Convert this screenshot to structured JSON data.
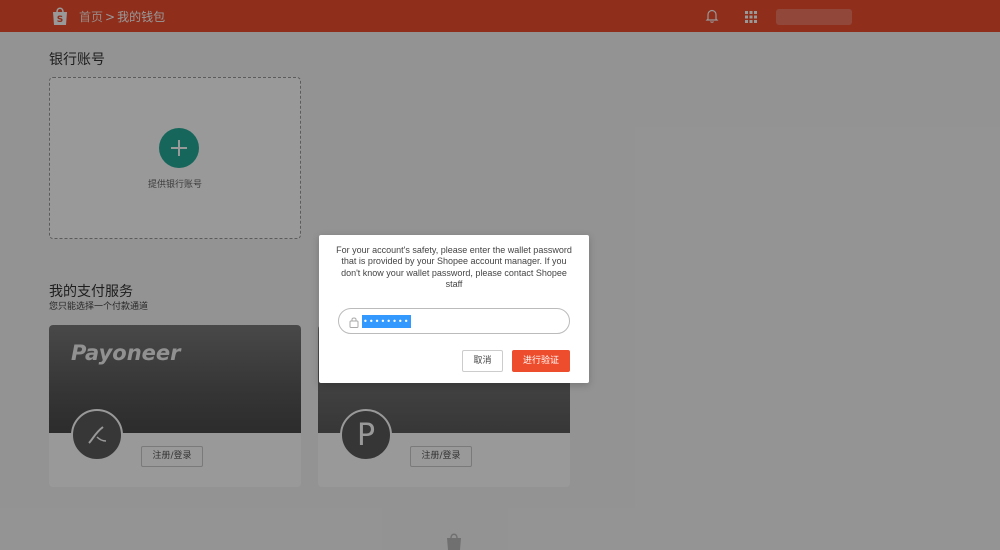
{
  "header": {
    "breadcrumb": {
      "home": "首页",
      "separator": ">",
      "current": "我的钱包"
    },
    "icons": [
      "shopee-bag-icon",
      "bell-icon",
      "apps-grid-icon"
    ],
    "color": "#ee4d2d"
  },
  "bank": {
    "title": "银行账号",
    "add_label": "提供银行账号",
    "accent": "#26aa99"
  },
  "payment": {
    "title": "我的支付服务",
    "subtitle": "您只能选择一个付款通道",
    "cards": [
      {
        "brand": "Payoneer",
        "register_label": "注册/登录"
      },
      {
        "brand_letter": "P",
        "register_label": "注册/登录"
      }
    ]
  },
  "modal": {
    "message": "For your account's safety, please enter the wallet password that is provided by your Shopee account manager. If you don't know your wallet password, please contact Shopee staff",
    "password_value": "••••••••",
    "cancel_label": "取消",
    "verify_label": "进行验证",
    "verify_color": "#ee4d2d"
  }
}
